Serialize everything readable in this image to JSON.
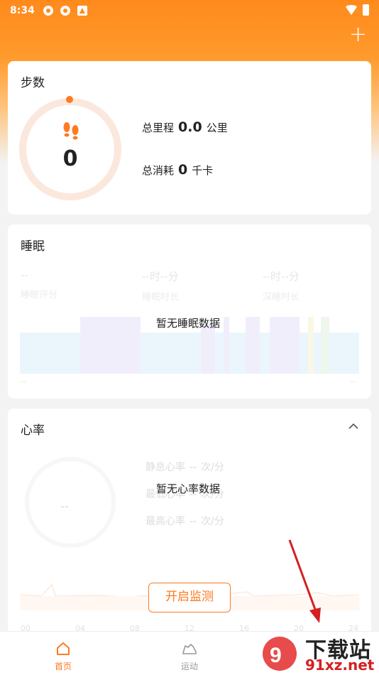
{
  "status_bar": {
    "time": "8:34"
  },
  "steps_card": {
    "title": "步数",
    "steps": "0",
    "distance_label": "总里程",
    "distance_value": "0.0",
    "distance_unit": "公里",
    "calories_label": "总消耗",
    "calories_value": "0",
    "calories_unit": "千卡"
  },
  "sleep_card": {
    "title": "睡眠",
    "score_value": "--",
    "score_label": "睡眠评分",
    "duration_value": "--时--分",
    "duration_label": "睡眠时长",
    "deep_value": "--时--分",
    "deep_label": "深睡时长",
    "empty_message": "暂无睡眠数据",
    "axis_start": "--",
    "axis_end": "--"
  },
  "heart_card": {
    "title": "心率",
    "empty_message": "暂无心率数据",
    "gauge_value": "--",
    "resting_label": "静息心率",
    "resting_value": "--",
    "unit": "次/分",
    "lowest_label": "最低心率",
    "lowest_value": "--",
    "highest_label": "最高心率",
    "highest_value": "--",
    "start_button": "开启监测",
    "axis_ticks": [
      "00",
      "04",
      "08",
      "12",
      "16",
      "20",
      "24"
    ]
  },
  "bottom_nav": {
    "items": [
      {
        "label": "首页",
        "icon": "home-icon",
        "active": true
      },
      {
        "label": "运动",
        "icon": "shoe-icon",
        "active": false
      }
    ]
  },
  "watermark": {
    "text": "下载站",
    "domain": "91xz.net"
  },
  "colors": {
    "accent": "#ff7a22",
    "header": "#ff8a1c"
  }
}
